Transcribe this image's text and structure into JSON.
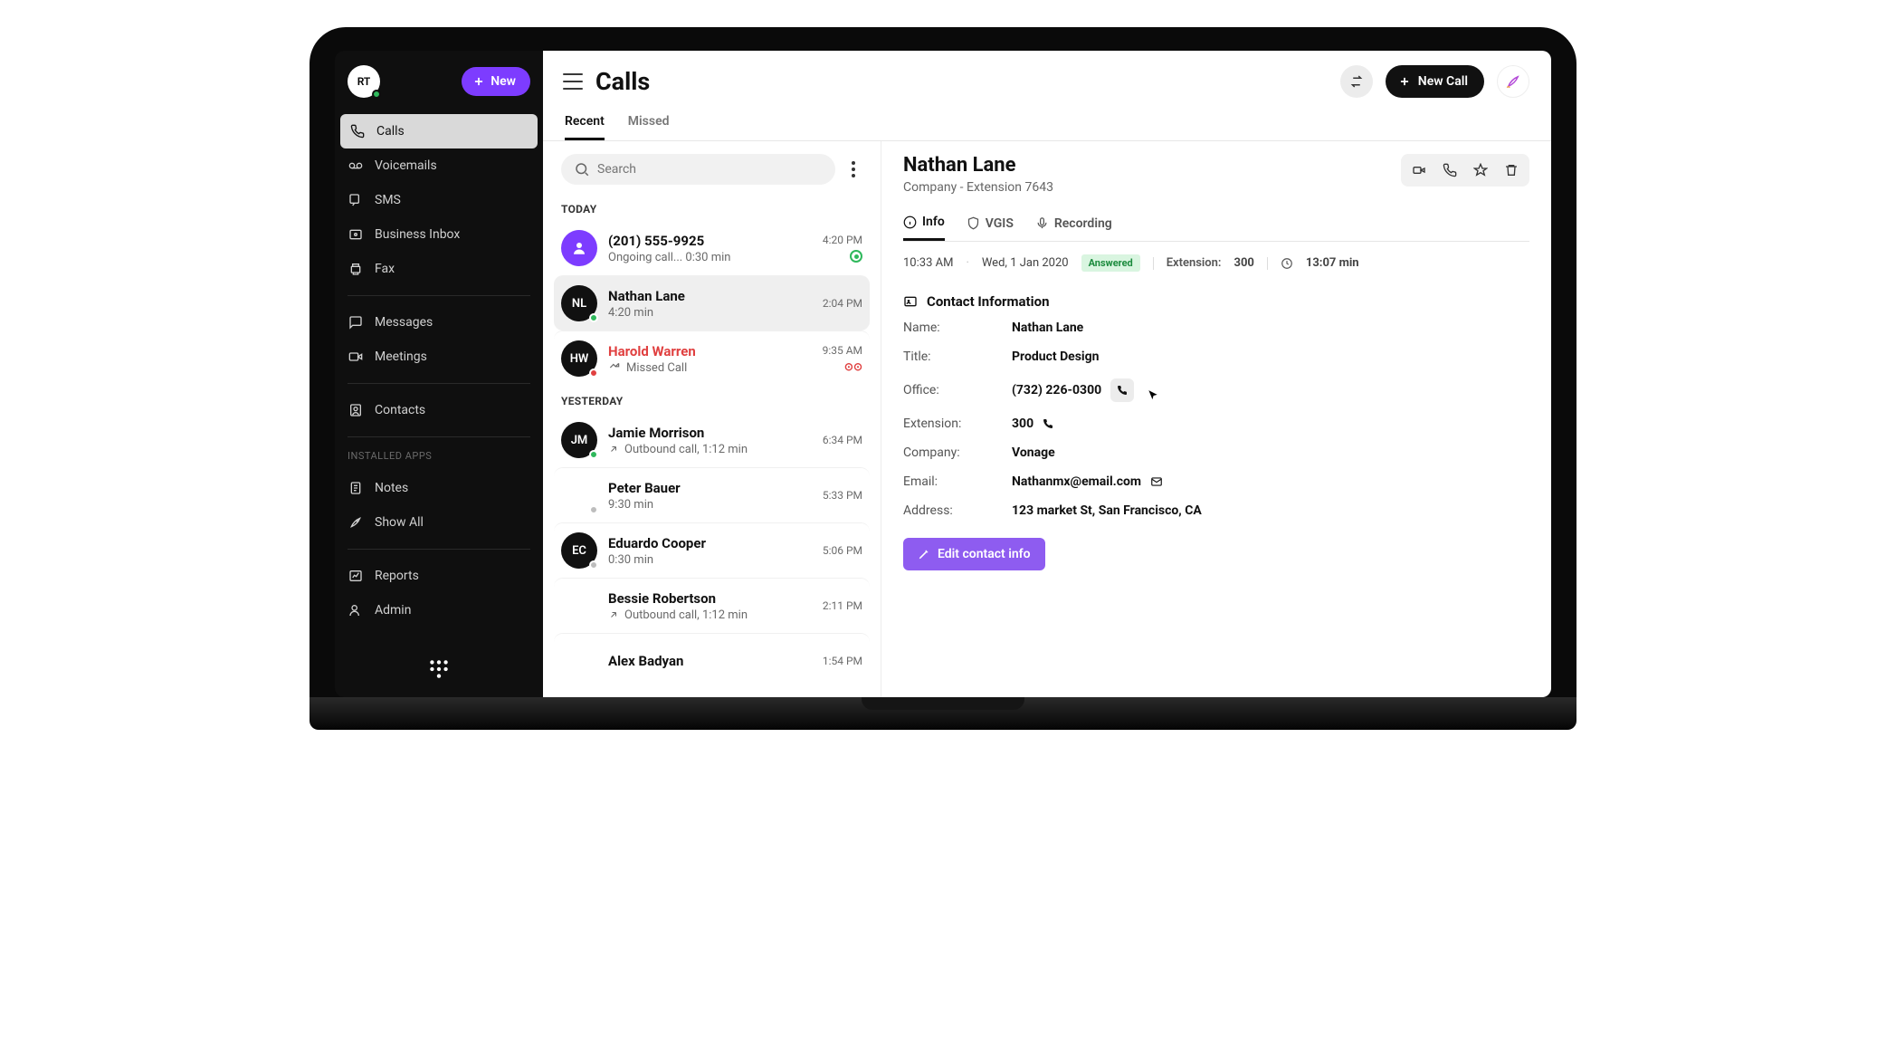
{
  "sidebar": {
    "avatar_initials": "RT",
    "new_label": "New",
    "items": [
      {
        "label": "Calls"
      },
      {
        "label": "Voicemails"
      },
      {
        "label": "SMS"
      },
      {
        "label": "Business Inbox"
      },
      {
        "label": "Fax"
      }
    ],
    "items2": [
      {
        "label": "Messages"
      },
      {
        "label": "Meetings"
      }
    ],
    "items3": [
      {
        "label": "Contacts"
      }
    ],
    "installed_label": "INSTALLED APPS",
    "items4": [
      {
        "label": "Notes"
      },
      {
        "label": "Show All"
      }
    ],
    "items5": [
      {
        "label": "Reports"
      },
      {
        "label": "Admin"
      }
    ]
  },
  "header": {
    "title": "Calls",
    "new_call_label": "New Call"
  },
  "tabs": {
    "recent": "Recent",
    "missed": "Missed"
  },
  "search": {
    "placeholder": "Search"
  },
  "sections": {
    "today": "TODAY",
    "yesterday": "YESTERDAY"
  },
  "calls_today": [
    {
      "title": "(201) 555-9925",
      "sub": "Ongoing call... 0:30 min",
      "time": "4:20 PM"
    },
    {
      "title": "Nathan Lane",
      "sub": "4:20 min",
      "time": "2:04 PM",
      "initials": "NL"
    },
    {
      "title": "Harold Warren",
      "sub": "Missed Call",
      "time": "9:35 AM",
      "initials": "HW"
    }
  ],
  "calls_yesterday": [
    {
      "title": "Jamie Morrison",
      "sub": "Outbound call, 1:12 min",
      "time": "6:34 PM",
      "initials": "JM"
    },
    {
      "title": "Peter Bauer",
      "sub": "9:30 min",
      "time": "5:33 PM"
    },
    {
      "title": "Eduardo Cooper",
      "sub": "0:30 min",
      "time": "5:06 PM",
      "initials": "EC"
    },
    {
      "title": "Bessie Robertson",
      "sub": "Outbound call, 1:12 min",
      "time": "2:11 PM"
    },
    {
      "title": "Alex Badyan",
      "sub": "",
      "time": "1:54 PM"
    }
  ],
  "detail": {
    "name": "Nathan Lane",
    "subtitle": "Company -  Extension 7643",
    "tabs": {
      "info": "Info",
      "vgis": "VGIS",
      "recording": "Recording"
    },
    "meta": {
      "time": "10:33 AM",
      "date": "Wed, 1 Jan 2020",
      "status": "Answered",
      "ext_label": "Extension:",
      "ext_value": "300",
      "duration": "13:07 min"
    },
    "section_title": "Contact Information",
    "fields": {
      "name_k": "Name:",
      "name_v": "Nathan Lane",
      "title_k": "Title:",
      "title_v": "Product  Design",
      "office_k": "Office:",
      "office_v": "(732) 226-0300",
      "ext_k": "Extension:",
      "ext_v": "300",
      "company_k": "Company:",
      "company_v": "Vonage",
      "email_k": "Email:",
      "email_v": "Nathanmx@email.com",
      "address_k": "Address:",
      "address_v": "123 market St, San Francisco, CA"
    },
    "edit_label": "Edit contact info"
  }
}
